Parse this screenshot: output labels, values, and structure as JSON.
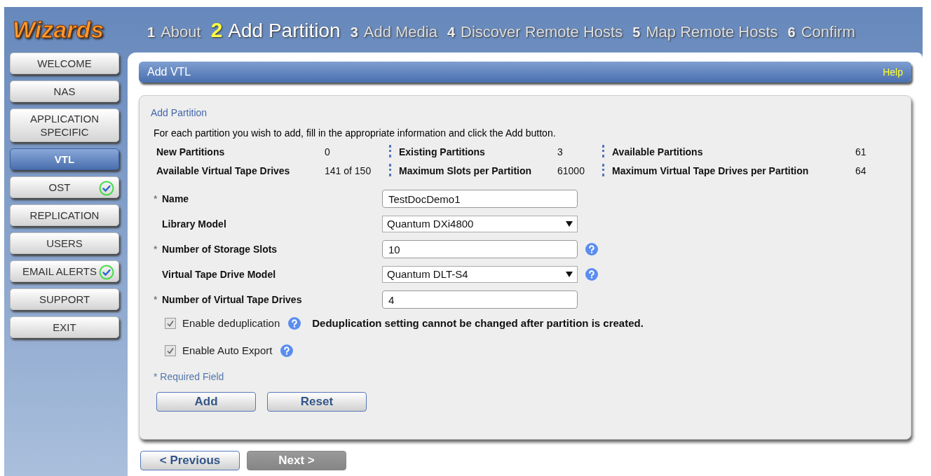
{
  "logo": "Wizards",
  "steps": [
    {
      "number": "1",
      "label": "About",
      "selected": false
    },
    {
      "number": "2",
      "label": "Add Partition",
      "selected": true
    },
    {
      "number": "3",
      "label": "Add Media",
      "selected": false
    },
    {
      "number": "4",
      "label": "Discover Remote Hosts",
      "selected": false
    },
    {
      "number": "5",
      "label": "Map Remote Hosts",
      "selected": false
    },
    {
      "number": "6",
      "label": "Confirm",
      "selected": false
    }
  ],
  "sidebar": {
    "items": [
      {
        "label": "WELCOME",
        "selected": false,
        "completed": false
      },
      {
        "label": "NAS",
        "selected": false,
        "completed": false
      },
      {
        "label": "APPLICATION SPECIFIC",
        "selected": false,
        "completed": false
      },
      {
        "label": "VTL",
        "selected": true,
        "completed": false
      },
      {
        "label": "OST",
        "selected": false,
        "completed": true
      },
      {
        "label": "REPLICATION",
        "selected": false,
        "completed": false
      },
      {
        "label": "USERS",
        "selected": false,
        "completed": false
      },
      {
        "label": "EMAIL ALERTS",
        "selected": false,
        "completed": true
      },
      {
        "label": "SUPPORT",
        "selected": false,
        "completed": false
      },
      {
        "label": "EXIT",
        "selected": false,
        "completed": false
      }
    ]
  },
  "panel": {
    "title": "Add VTL",
    "help": "Help"
  },
  "section": {
    "title": "Add Partition",
    "instructions": "For each partition you wish to add, fill in the appropriate information and click the Add button.",
    "stats": [
      [
        {
          "label": "New Partitions",
          "value": "0"
        },
        {
          "label": "Existing Partitions",
          "value": "3"
        },
        {
          "label": "Available Partitions",
          "value": "61"
        }
      ],
      [
        {
          "label": "Available Virtual Tape Drives",
          "value": "141 of 150"
        },
        {
          "label": "Maximum Slots per Partition",
          "value": "61000"
        },
        {
          "label": "Maximum Virtual Tape Drives per Partition",
          "value": "64"
        }
      ]
    ],
    "fields": [
      {
        "kind": "text",
        "mark": "*",
        "label": "Name",
        "value": "TestDocDemo1",
        "help": false
      },
      {
        "kind": "select",
        "label": "Library Model",
        "value": "Quantum DXi4800",
        "help": false
      },
      {
        "kind": "text",
        "mark": "*",
        "label": "Number of Storage Slots",
        "value": "10",
        "help": true
      },
      {
        "kind": "select",
        "label": "Virtual Tape Drive Model",
        "value": "Quantum DLT-S4",
        "help": true
      },
      {
        "kind": "text",
        "mark": "*",
        "label": "Number of Virtual Tape Drives",
        "value": "4",
        "help": false
      }
    ],
    "checkboxes": [
      {
        "label": "Enable deduplication",
        "checked": true,
        "note": "Deduplication setting cannot be changed after partition is created."
      },
      {
        "label": "Enable Auto Export",
        "checked": true
      }
    ],
    "required_note": "* Required Field",
    "actions": [
      "Add",
      "Reset"
    ]
  },
  "nav": [
    {
      "label": "< Previous",
      "disabled": false
    },
    {
      "label": "Next >",
      "disabled": true
    }
  ]
}
